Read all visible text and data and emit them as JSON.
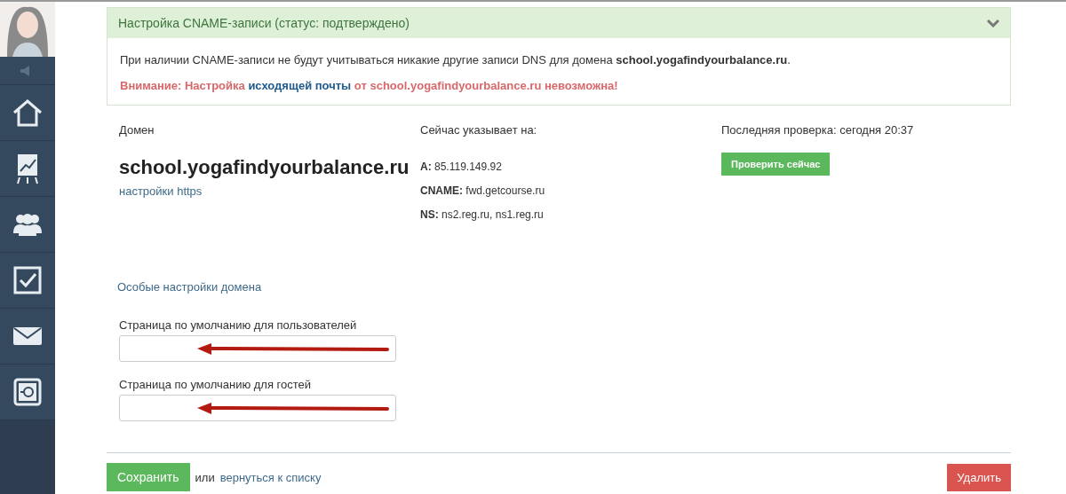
{
  "panel": {
    "title": "Настройка CNAME-записи (статус: подтверждено)",
    "expanded": true,
    "note": "При наличии CNAME-записи не будут учитываться никакие другие записи DNS для домена **school.yogafindyourbalance.ru**.",
    "warning": [
      {
        "kind": "text",
        "text": "Внимание: Настройка"
      },
      {
        "kind": "link",
        "text": "исходящей почты"
      },
      {
        "kind": "text",
        "text": "от school.yogafindyourbalance.ru невозможна!"
      }
    ]
  },
  "domain": {
    "label": "Домен",
    "name": "school.yogafindyourbalance.ru",
    "https_link": "настройки https"
  },
  "points_to": {
    "label": "Сейчас указывает на:",
    "records": [
      {
        "type": "A:",
        "value": "85.119.149.92"
      },
      {
        "type": "CNAME:",
        "value": "fwd.getcourse.ru"
      },
      {
        "type": "NS:",
        "value": "ns2.reg.ru, ns1.reg.ru"
      }
    ]
  },
  "last_check": {
    "label": "Последняя проверка: сегодня 20:37",
    "button": "Проверить сейчас"
  },
  "special_link": "Особые настройки домена",
  "fields": [
    {
      "label": "Страница по умолчанию для пользователей"
    },
    {
      "label": "Страница по умолчанию для гостей"
    }
  ],
  "footer": {
    "save": "Сохранить",
    "or": "или",
    "back_link": "вернуться к списку",
    "delete": "Удалить"
  }
}
